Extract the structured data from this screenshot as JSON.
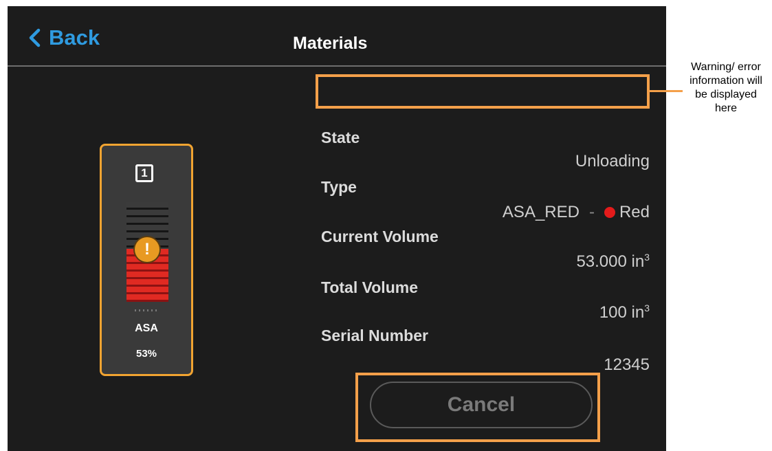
{
  "header": {
    "back_label": "Back",
    "title": "Materials"
  },
  "material_card": {
    "slot_number": "1",
    "material": "ASA",
    "fill_percent_label": "53%",
    "fill_fraction": 0.53,
    "warning_icon_glyph": "!",
    "fill_color": "#e02a22",
    "accent_color": "#f2a431"
  },
  "details": {
    "state_label": "State",
    "state_value": "Unloading",
    "type_label": "Type",
    "type_value": "ASA_RED",
    "type_separator": "-",
    "color_name": "Red",
    "color_swatch": "#e41b1b",
    "current_volume_label": "Current Volume",
    "current_volume_value": "53.000 in",
    "current_volume_unit_sup": "3",
    "total_volume_label": "Total Volume",
    "total_volume_value": "100 in",
    "total_volume_unit_sup": "3",
    "serial_label": "Serial Number",
    "serial_value": "12345"
  },
  "actions": {
    "cancel_label": "Cancel"
  },
  "annotation": {
    "callout_text": "Warning/ error information will be displayed here",
    "highlight_color": "#f4a04a"
  }
}
